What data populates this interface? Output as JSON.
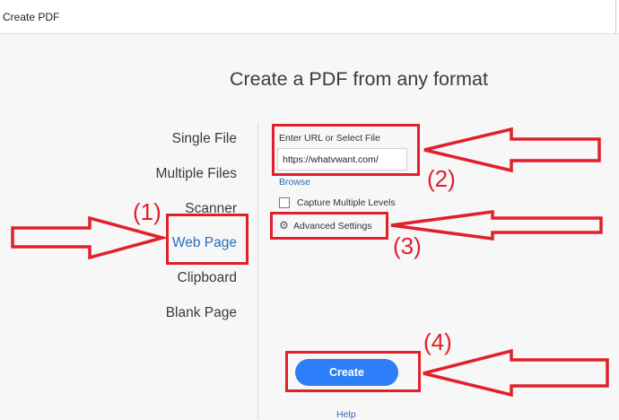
{
  "window": {
    "title": "Create PDF"
  },
  "heading": "Create a PDF from any format",
  "nav": {
    "items": [
      {
        "label": "Single File",
        "active": false
      },
      {
        "label": "Multiple Files",
        "active": false
      },
      {
        "label": "Scanner",
        "active": false
      },
      {
        "label": "Web Page",
        "active": true
      },
      {
        "label": "Clipboard",
        "active": false
      },
      {
        "label": "Blank Page",
        "active": false
      }
    ]
  },
  "form": {
    "url_label": "Enter URL or Select File",
    "url_value": "https://whatvwant.com/",
    "browse_label": "Browse",
    "capture_label": "Capture Multiple Levels",
    "capture_checked": false,
    "advanced_label": "Advanced Settings",
    "advanced_icon": "gear-icon"
  },
  "actions": {
    "create_label": "Create",
    "help_label": "Help"
  },
  "annotations": {
    "color": "#e0202a",
    "labels": [
      "(1)",
      "(2)",
      "(3)",
      "(4)"
    ]
  },
  "colors": {
    "accent": "#2d7ff9",
    "link": "#2a6ebb"
  }
}
